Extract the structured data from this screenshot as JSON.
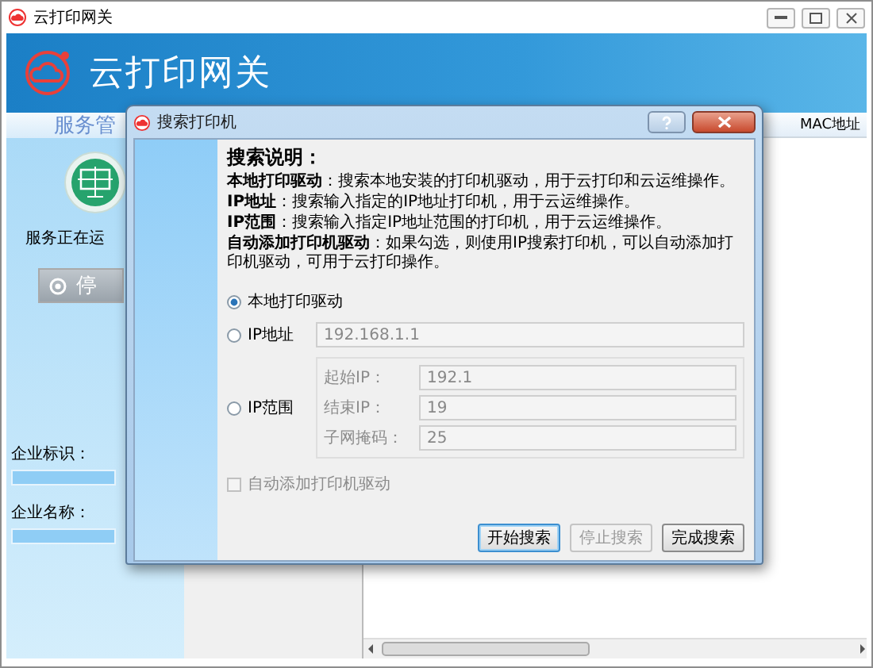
{
  "window": {
    "title": "云打印网关",
    "app_name": "云打印网关"
  },
  "sidebar": {
    "tab": "服务管",
    "status": "服务正在运",
    "stop_button": "停",
    "fields": [
      {
        "label": "企业标识："
      },
      {
        "label": "企业名称："
      }
    ]
  },
  "table": {
    "columns": [
      "MAC地址"
    ]
  },
  "dialog": {
    "title": "搜索打印机",
    "heading": "搜索说明：",
    "notes": [
      "**本地打印驱动**：搜索本地安装的打印机驱动，用于云打印和云运维操作。",
      "**IP地址**：搜索输入指定的IP地址打印机，用于云运维操作。",
      "**IP范围**：搜索输入指定IP地址范围的打印机，用于云运维操作。",
      "**自动添加打印机驱动**：如果勾选，则使用IP搜索打印机，可以自动添加打印机驱动，可用于云打印操作。"
    ],
    "options": [
      {
        "kind": "radio",
        "label": "本地打印驱动",
        "selected": true
      },
      {
        "kind": "radio",
        "label": "IP地址",
        "selected": false,
        "value": "192.168.1.1"
      },
      {
        "kind": "range",
        "label": "IP范围",
        "selected": false,
        "fields": [
          {
            "label": "起始IP：",
            "value": "192.1"
          },
          {
            "label": "结束IP：",
            "value": "19"
          },
          {
            "label": "子网掩码：",
            "value": "25"
          }
        ]
      }
    ],
    "auto_add": {
      "label": "自动添加打印机驱动",
      "checked": false,
      "disabled": true
    },
    "buttons": [
      {
        "label": "开始搜索",
        "default": true,
        "disabled": false
      },
      {
        "label": "停止搜索",
        "default": false,
        "disabled": true
      },
      {
        "label": "完成搜索",
        "default": false,
        "disabled": false
      }
    ]
  }
}
